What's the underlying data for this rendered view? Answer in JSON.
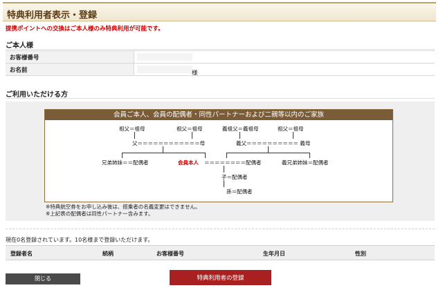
{
  "title": "特典利用者表示・登録",
  "notice": "提携ポイントへの交換はご本人様のみ特典利用が可能です。",
  "self_section": {
    "heading": "ご本人様",
    "rows": [
      {
        "label": "お客様番号",
        "value": ""
      },
      {
        "label": "お名前",
        "suffix": "様"
      }
    ]
  },
  "usable_section": {
    "heading": "ご利用いただける方",
    "tree_title": "会員ご本人、会員の配偶者・同性パートナーおよび二親等以内のご家族",
    "tree": {
      "gp1": "祖父＝祖母",
      "gp2": "祖父＝祖母",
      "gp3": "義祖父＝義祖母",
      "gp4": "祖父＝祖母",
      "parents": "父＝＝＝＝＝＝＝＝＝＝＝＝母",
      "inlaw_parents": "義父＝＝＝＝＝＝＝＝＝＝ 義母",
      "siblings": "兄弟姉妹＝＝配偶者",
      "member": "会員本人",
      "member_spouse": "＝＝＝＝＝＝＝＝配偶者",
      "inlaw_siblings": "義兄弟姉妹＝配偶者",
      "child": "子＝配偶者",
      "grandchild": "孫＝配偶者"
    },
    "notes": [
      "※特典航空券をお申し込み後は、搭乗者の名義変更はできません。",
      "※上記表の配偶者は同性パートナー含みます。"
    ]
  },
  "registration": {
    "count_text": "現在0名登録されています。10名様まで登録いただけます。",
    "columns": [
      "登録者名",
      "続柄",
      "お客様番号",
      "生年月日",
      "性別"
    ]
  },
  "buttons": {
    "close": "閉じる",
    "register": "特典利用者の登録"
  },
  "colors": {
    "title_text": "#5a3b14",
    "notice": "#cc0000",
    "tree_header": "#7a5c38",
    "register_button": "#a92020",
    "close_button": "#4a4a4a"
  }
}
